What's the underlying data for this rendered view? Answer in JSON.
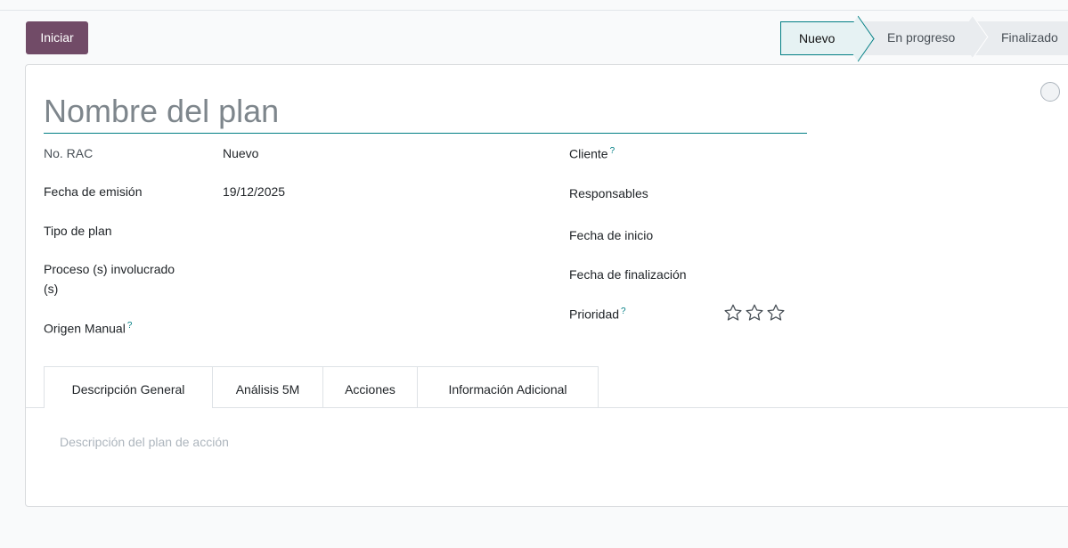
{
  "toolbar": {
    "start_label": "Iniciar"
  },
  "statusbar": {
    "stages": [
      "Nuevo",
      "En progreso",
      "Finalizado"
    ],
    "active_index": 0
  },
  "form": {
    "title_placeholder": "Nombre del plan",
    "left_fields": [
      {
        "label": "No. RAC",
        "value": "Nuevo"
      },
      {
        "label": "Fecha de emisión",
        "value": "19/12/2025"
      },
      {
        "label": "Tipo de plan",
        "value": ""
      },
      {
        "label": "Proceso (s) involucrado",
        "label2": "(s)",
        "value": ""
      },
      {
        "label": "Origen Manual",
        "help": "?",
        "value": ""
      }
    ],
    "right_fields": [
      {
        "label": "Cliente",
        "help": "?"
      },
      {
        "label": "Responsables"
      },
      {
        "label": "Fecha de inicio"
      },
      {
        "label": "Fecha de finalización"
      },
      {
        "label": "Prioridad",
        "help": "?"
      }
    ],
    "priority": {
      "value": 0,
      "max": 3
    }
  },
  "tabs": [
    "Descripción General",
    "Análisis 5M",
    "Acciones",
    "Información Adicional"
  ],
  "description_placeholder": "Descripción del plan de acción",
  "colors": {
    "primary": "#714b67",
    "accent": "#017e84"
  }
}
